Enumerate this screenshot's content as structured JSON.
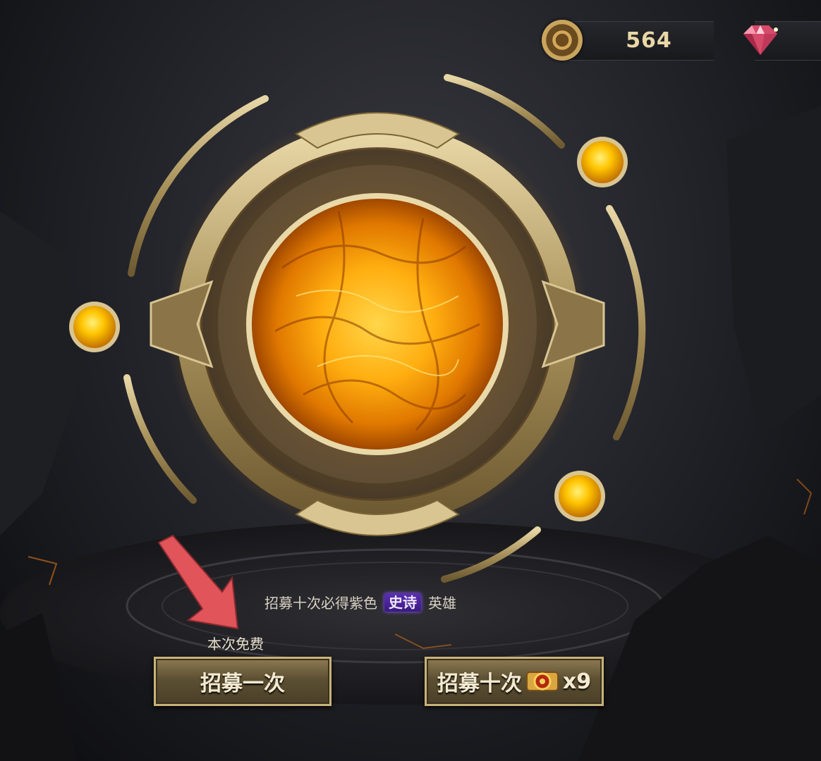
{
  "currency": {
    "coin_value": "564",
    "coin_icon": "gold-coin-icon",
    "gem_icon": "red-gem-icon"
  },
  "banner": {
    "hint_prefix": "招募十次必得紫色",
    "hint_badge": "史诗",
    "hint_suffix": "英雄"
  },
  "recruit": {
    "free_label": "本次免费",
    "once_label": "招募一次",
    "ten_label": "招募十次",
    "ten_cost_icon": "recruit-ticket-icon",
    "ten_cost": "x9"
  },
  "colors": {
    "orb": "#ffb000",
    "gold_frame": "#c9b27a",
    "epic": "#5a2fb0",
    "arrow": "#e0545a"
  }
}
